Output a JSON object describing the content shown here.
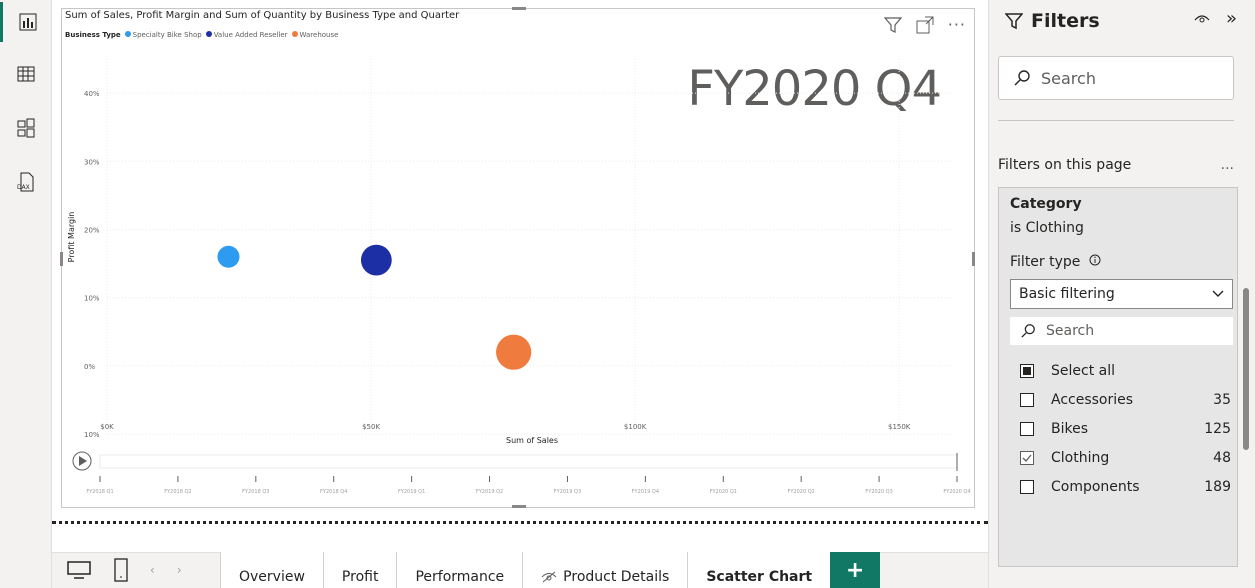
{
  "left_nav": {
    "items": [
      {
        "icon": "report-view-icon",
        "active": true
      },
      {
        "icon": "table-view-icon",
        "active": false
      },
      {
        "icon": "model-view-icon",
        "active": false
      },
      {
        "icon": "dax-query-view-icon",
        "active": false
      }
    ]
  },
  "visual": {
    "title": "Sum of Sales, Profit Margin and Sum of Quantity by Business Type and Quarter",
    "legend_label": "Business Type",
    "legend": [
      {
        "name": "Specialty Bike Shop",
        "color": "#2d9cf0"
      },
      {
        "name": "Value Added Reseller",
        "color": "#1c2fa5"
      },
      {
        "name": "Warehouse",
        "color": "#f07b3f"
      }
    ],
    "play_axis_value": "FY2020 Q4"
  },
  "chart_data": {
    "type": "scatter",
    "title": "Sum of Sales, Profit Margin and Sum of Quantity by Business Type and Quarter",
    "xlabel": "Sum of Sales",
    "ylabel": "Profit Margin",
    "x_ticks": [
      "$0K",
      "$50K",
      "$100K",
      "$150K"
    ],
    "x_tick_values": [
      0,
      50,
      100,
      150
    ],
    "y_ticks": [
      "40%",
      "30%",
      "20%",
      "10%",
      "0%",
      "10%"
    ],
    "y_tick_values": [
      40,
      30,
      20,
      10,
      0,
      -10
    ],
    "xlim": [
      0,
      160
    ],
    "ylim": [
      -10,
      45
    ],
    "series": [
      {
        "name": "Specialty Bike Shop",
        "x": 23,
        "y": 16,
        "size": 1,
        "color": "#2d9cf0"
      },
      {
        "name": "Value Added Reseller",
        "x": 51,
        "y": 15.5,
        "size": 1.4,
        "color": "#1c2fa5"
      },
      {
        "name": "Warehouse",
        "x": 77,
        "y": 2,
        "size": 1.6,
        "color": "#f07b3f"
      }
    ],
    "play_axis": [
      "FY2018 Q1",
      "FY2018 Q2",
      "FY2018 Q3",
      "FY2018 Q4",
      "FY2019 Q1",
      "FY2019 Q2",
      "FY2019 Q3",
      "FY2019 Q4",
      "FY2020 Q1",
      "FY2020 Q2",
      "FY2020 Q3",
      "FY2020 Q4"
    ]
  },
  "tabs": [
    {
      "label": "Overview",
      "active": false
    },
    {
      "label": "Profit",
      "active": false
    },
    {
      "label": "Performance",
      "active": false
    },
    {
      "label": "Product Details",
      "active": false,
      "hidden": true
    },
    {
      "label": "Scatter Chart",
      "active": true
    }
  ],
  "tab_add_label": "+",
  "filters": {
    "title": "Filters",
    "search_placeholder": "Search",
    "section_title": "Filters on this page",
    "section_more": "...",
    "card": {
      "field": "Category",
      "summary": "is Clothing",
      "filter_type_label": "Filter type",
      "filter_type_value": "Basic filtering",
      "search_placeholder": "Search",
      "items": [
        {
          "label": "Select all",
          "count": "",
          "state": "partial"
        },
        {
          "label": "Accessories",
          "count": "35",
          "state": "unchecked"
        },
        {
          "label": "Bikes",
          "count": "125",
          "state": "unchecked"
        },
        {
          "label": "Clothing",
          "count": "48",
          "state": "checked"
        },
        {
          "label": "Components",
          "count": "189",
          "state": "unchecked"
        }
      ]
    }
  }
}
